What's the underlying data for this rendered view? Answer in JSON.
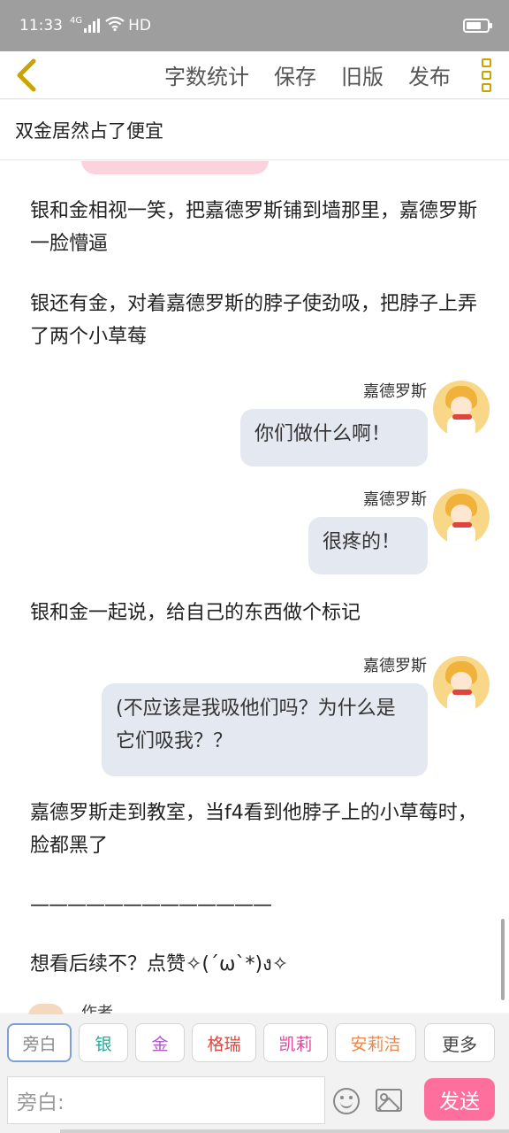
{
  "status_bar": {
    "time": "11:33",
    "network": "4G",
    "hd": "HD"
  },
  "toolbar": {
    "word_count": "字数统计",
    "save": "保存",
    "old_version": "旧版",
    "publish": "发布"
  },
  "title": "双金居然占了便宜",
  "story": {
    "p1": "银和金相视一笑，把嘉德罗斯铺到墙那里，嘉德罗斯一脸懵逼",
    "p2": "银还有金，对着嘉德罗斯的脖子使劲吸，把脖子上弄了两个小草莓",
    "d1_speaker": "嘉德罗斯",
    "d1_text": "你们做什么啊！",
    "d2_speaker": "嘉德罗斯",
    "d2_text": "很疼的！",
    "p3": "银和金一起说，给自己的东西做个标记",
    "d3_speaker": "嘉德罗斯",
    "d3_text": "(不应该是我吸他们吗？为什么是它们吸我？？",
    "p4": "嘉德罗斯走到教室，当f4看到他脖子上的小草莓时，脸都黑了",
    "p5": "—————————————",
    "p6": "想看后续不？点赞✧(´ω`*)ง✧",
    "author_label": "作者"
  },
  "roles": [
    {
      "label": "旁白",
      "color": "#888888"
    },
    {
      "label": "银",
      "color": "#2aa89a"
    },
    {
      "label": "金",
      "color": "#b05ac8"
    },
    {
      "label": "格瑞",
      "color": "#e0443e"
    },
    {
      "label": "凯莉",
      "color": "#e0479e"
    },
    {
      "label": "安莉洁",
      "color": "#f0874a"
    }
  ],
  "more_label": "更多",
  "input": {
    "placeholder": "旁白:"
  },
  "send_label": "发送",
  "colors": {
    "accent_pink": "#ff6f9e",
    "bubble": "#e4e9f1",
    "back_arrow": "#c9a400"
  }
}
